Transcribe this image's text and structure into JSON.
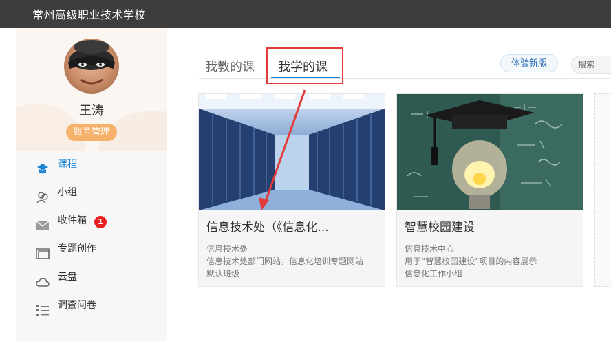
{
  "header": {
    "school_name": "常州高级职业技术学校"
  },
  "profile": {
    "name": "王涛",
    "account_button": "账号管理"
  },
  "sidebar": {
    "items": [
      {
        "label": "课程",
        "icon": "course-icon",
        "active": true
      },
      {
        "label": "小组",
        "icon": "group-icon"
      },
      {
        "label": "收件箱",
        "icon": "inbox-icon",
        "badge": "1"
      },
      {
        "label": "专题创作",
        "icon": "topic-icon"
      },
      {
        "label": "云盘",
        "icon": "cloud-icon"
      },
      {
        "label": "调查问卷",
        "icon": "survey-icon"
      }
    ]
  },
  "main": {
    "tabs": [
      {
        "label": "我教的课"
      },
      {
        "label": "我学的课",
        "selected": true
      }
    ],
    "try_new_button": "体验新版",
    "search_placeholder": "搜索",
    "courses": [
      {
        "title": "信息技术处（《信息化...",
        "lines": [
          "信息技术处",
          "信息技术处部门网站，信息化培训专题网站",
          "默认班级"
        ]
      },
      {
        "title": "智慧校园建设",
        "lines": [
          "信息技术中心",
          "用于“智慧校园建设”项目的内容展示",
          "信息化工作小组"
        ]
      }
    ]
  },
  "colors": {
    "accent": "#1f86d6",
    "highlight_box": "#e33a3a",
    "badge": "#e81d1d",
    "account_button": "#f6b26b"
  }
}
